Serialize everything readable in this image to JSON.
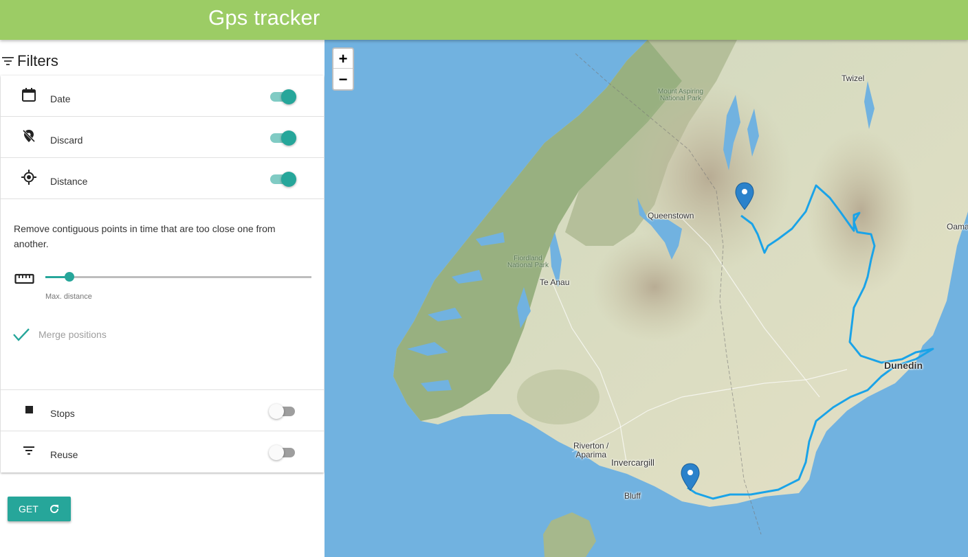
{
  "header": {
    "title": "Gps tracker"
  },
  "filters": {
    "title": "Filters",
    "rows": [
      {
        "label": "Date",
        "enabled": true,
        "icon": "calendar-icon"
      },
      {
        "label": "Discard",
        "enabled": true,
        "icon": "location-off-icon"
      },
      {
        "label": "Distance",
        "enabled": true,
        "icon": "gps-crosshair-icon"
      }
    ],
    "distance_panel": {
      "description": "Remove contiguous points in time that are too close one from another.",
      "slider_label": "Max. distance",
      "slider_value_fraction": 0.09,
      "merge_label": "Merge positions",
      "merge_checked": true
    },
    "bottom_rows": [
      {
        "label": "Stops",
        "enabled": false,
        "icon": "stop-square-icon"
      },
      {
        "label": "Reuse",
        "enabled": false,
        "icon": "filter-icon"
      }
    ]
  },
  "get_button": {
    "label": "GET",
    "icon": "refresh-icon"
  },
  "map": {
    "zoom_in": "+",
    "zoom_out": "−",
    "places": {
      "twizel": "Twizel",
      "mount_aspiring_1": "Mount Aspiring",
      "mount_aspiring_2": "National Park",
      "queenstown": "Queenstown",
      "oamaru": "Oama",
      "fiordland_1": "Fiordland",
      "fiordland_2": "National Park",
      "te_anau": "Te Anau",
      "dunedin": "Dunedin",
      "riverton_1": "Riverton /",
      "riverton_2": "Aparima",
      "invercargill": "Invercargill",
      "bluff": "Bluff"
    }
  },
  "colors": {
    "header_bg": "#9ccc65",
    "accent": "#26a69a",
    "sea": "#71b2e0",
    "track": "#1aa3e8",
    "marker": "#2b82cb"
  }
}
